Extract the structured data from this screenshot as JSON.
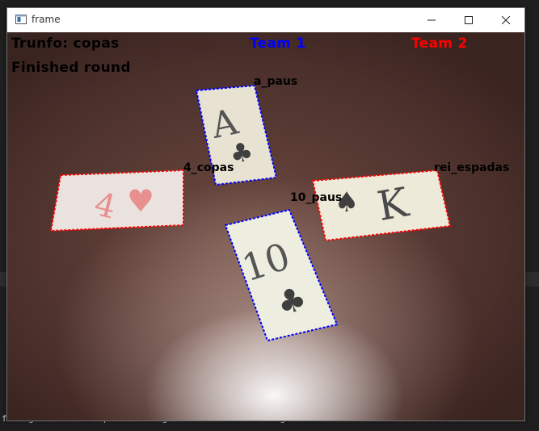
{
  "window": {
    "title": "frame"
  },
  "hud": {
    "trunfo": "Trunfo: copas",
    "status": "Finished round",
    "team1": "Team 1",
    "team2": "Team 2",
    "team1_color": "#0000ff",
    "team2_color": "#ff0000"
  },
  "cards": [
    {
      "label": "a_paus",
      "rank": "A",
      "suit": "♣",
      "team": "team1"
    },
    {
      "label": "4_copas",
      "rank": "4",
      "suit": "♥",
      "team": "team2"
    },
    {
      "label": "rei_espadas",
      "rank": "K",
      "suit": "♠",
      "team": "team2"
    },
    {
      "label": "10_paus",
      "rank": "10",
      "suit": "♣",
      "team": "team1"
    }
  ],
  "terminal": {
    "bottom_line": "fo registered is copas. Loading the cards... this might take a minute."
  },
  "icons": [
    "app-window-icon",
    "minimize-icon",
    "maximize-icon",
    "close-icon"
  ]
}
